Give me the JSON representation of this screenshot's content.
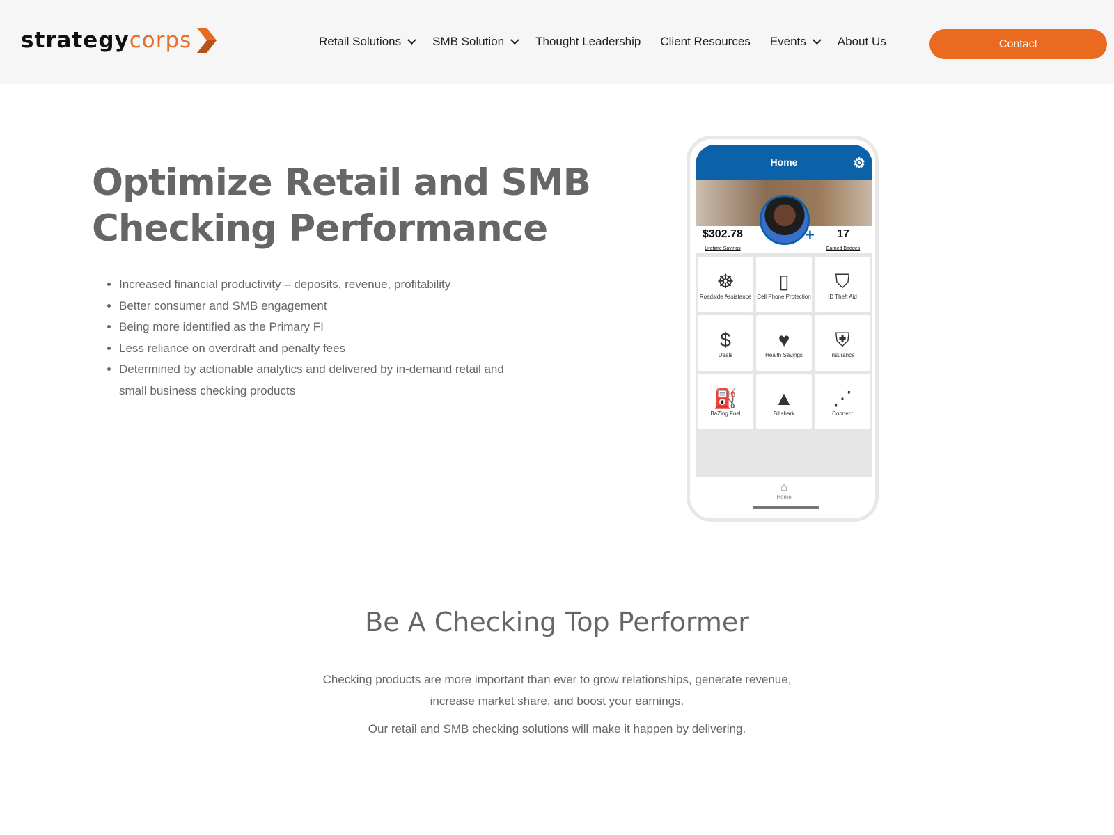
{
  "header": {
    "logo": {
      "part1": "strategy",
      "part2": "corps"
    },
    "nav": [
      {
        "label": "Retail Solutions",
        "dropdown": true
      },
      {
        "label": "SMB Solution",
        "dropdown": true
      },
      {
        "label": "Thought Leadership",
        "dropdown": false
      },
      {
        "label": "Client Resources",
        "dropdown": false
      },
      {
        "label": "Events",
        "dropdown": true
      },
      {
        "label": "About Us",
        "dropdown": false
      }
    ],
    "contact_label": "Contact",
    "accent": "#ea6b1f"
  },
  "hero": {
    "title_line1": "Optimize Retail and SMB",
    "title_line2": "Checking Performance",
    "bullets": [
      "Increased financial productivity – deposits, revenue, profitability",
      "Better consumer and SMB engagement",
      "Being more identified as the Primary FI",
      "Less reliance on overdraft and penalty fees",
      "Determined by actionable analytics and delivered by in-demand retail and small business checking products"
    ]
  },
  "phone": {
    "title": "Home",
    "savings": "$302.78",
    "savings_label": "Lifetime Savings",
    "badges": "17",
    "badges_label": "Earned Badges",
    "tiles": [
      {
        "label": "Roadside Assistance",
        "icon": "steering-wheel-icon",
        "glyph": "☸"
      },
      {
        "label": "Cell Phone Protection",
        "icon": "phone-icon",
        "glyph": "▯"
      },
      {
        "label": "ID Theft Aid",
        "icon": "id-theft-icon",
        "glyph": "⛉"
      },
      {
        "label": "Deals",
        "icon": "price-tag-icon",
        "glyph": "$"
      },
      {
        "label": "Health Savings",
        "icon": "heart-icon",
        "glyph": "♥"
      },
      {
        "label": "Insurance",
        "icon": "briefcase-shield-icon",
        "glyph": "⛨"
      },
      {
        "label": "BaZing Fuel",
        "icon": "fuel-pump-icon",
        "glyph": "⛽"
      },
      {
        "label": "Billshark",
        "icon": "shark-fin-icon",
        "glyph": "▲"
      },
      {
        "label": "Connect",
        "icon": "share-icon",
        "glyph": "⋰"
      }
    ],
    "tab_home": "Home",
    "brand_color": "#0b62a8"
  },
  "section": {
    "title": "Be A Checking Top Performer",
    "para1_line1": "Checking products are more important than ever to grow relationships, generate revenue,",
    "para1_line2": "increase market share, and boost your earnings.",
    "para2": "Our retail and SMB checking solutions will make it happen by delivering."
  }
}
